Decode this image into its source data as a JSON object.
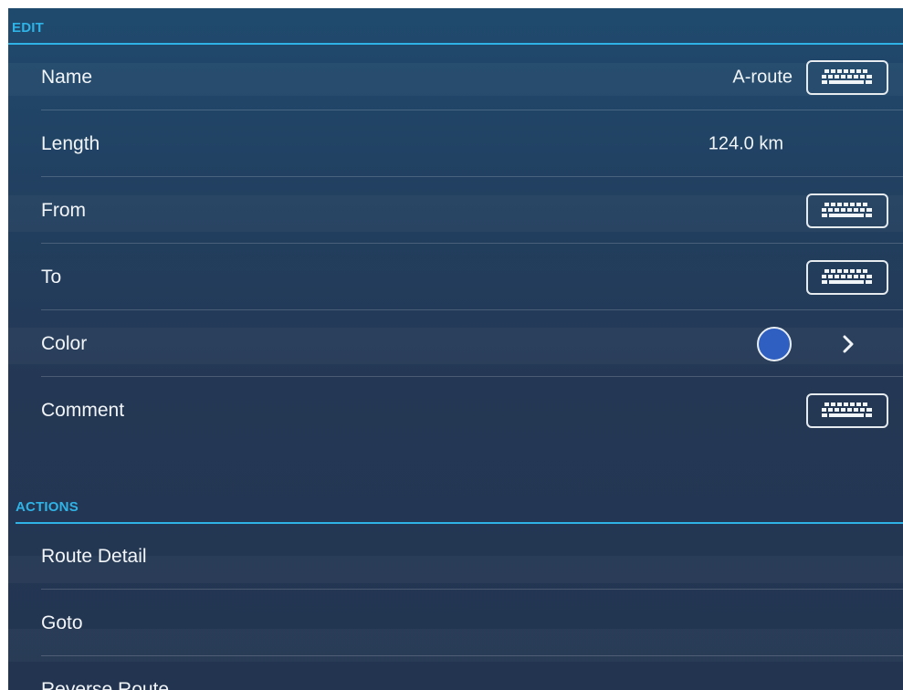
{
  "edit": {
    "title": "EDIT",
    "rows": [
      {
        "label": "Name",
        "value": "A-route",
        "icon": "keyboard-icon"
      },
      {
        "label": "Length",
        "value": "124.0 km"
      },
      {
        "label": "From",
        "value": "",
        "icon": "keyboard-icon"
      },
      {
        "label": "To",
        "value": "",
        "icon": "keyboard-icon"
      },
      {
        "label": "Color",
        "swatch_color": "#2f5fc0",
        "icon": "chevron-right-icon"
      },
      {
        "label": "Comment",
        "value": "",
        "icon": "keyboard-icon"
      }
    ]
  },
  "actions": {
    "title": "ACTIONS",
    "items": [
      {
        "label": "Route Detail"
      },
      {
        "label": "Goto"
      },
      {
        "label": "Reverse Route"
      }
    ]
  },
  "colors": {
    "accent": "#2fb3e6",
    "background_top": "#1f4a6e",
    "background_bottom": "#223450",
    "text": "#f2f5f8"
  }
}
